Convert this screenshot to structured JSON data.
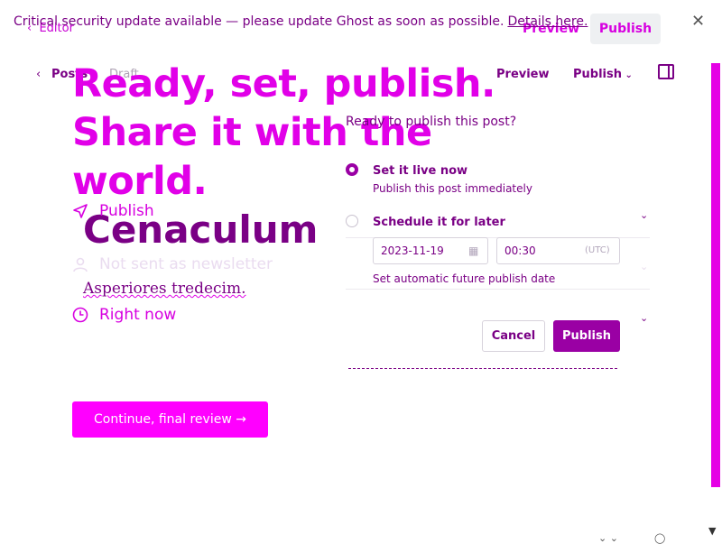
{
  "banner": {
    "message": "Critical security update available — please update Ghost as soon as possible.",
    "link": "Details here."
  },
  "topbar": {
    "editor_label": "Editor",
    "preview_label": "Preview",
    "publish_label": "Publish"
  },
  "editor_nav": {
    "posts_label": "Posts",
    "draft_label": "Draft",
    "preview_label": "Preview",
    "publish_label": "Publish"
  },
  "headline": {
    "line1": "Ready, set, publish.",
    "line2": "Share it with the world."
  },
  "post": {
    "title": "Cenaculum v",
    "excerpt": "Asperiores tredecim."
  },
  "options": {
    "publish_label": "Publish",
    "audience_label": "Not sent as newsletter",
    "time_label": "Right now"
  },
  "continue_label": "Continue, final review →",
  "panel": {
    "question": "Ready to publish this post?",
    "option1_title": "Set it live now",
    "option1_desc": "Publish this post immediately",
    "option2_title": "Schedule it for later",
    "date_value": "2023-11-19",
    "time_value": "00:30",
    "timezone": "(UTC)",
    "schedule_hint": "Set automatic future publish date",
    "cancel_label": "Cancel",
    "publish_label": "Publish"
  },
  "colors": {
    "accent": "#e100e8",
    "primary_dark": "#7a0085",
    "button_pink": "#ff00ff"
  }
}
